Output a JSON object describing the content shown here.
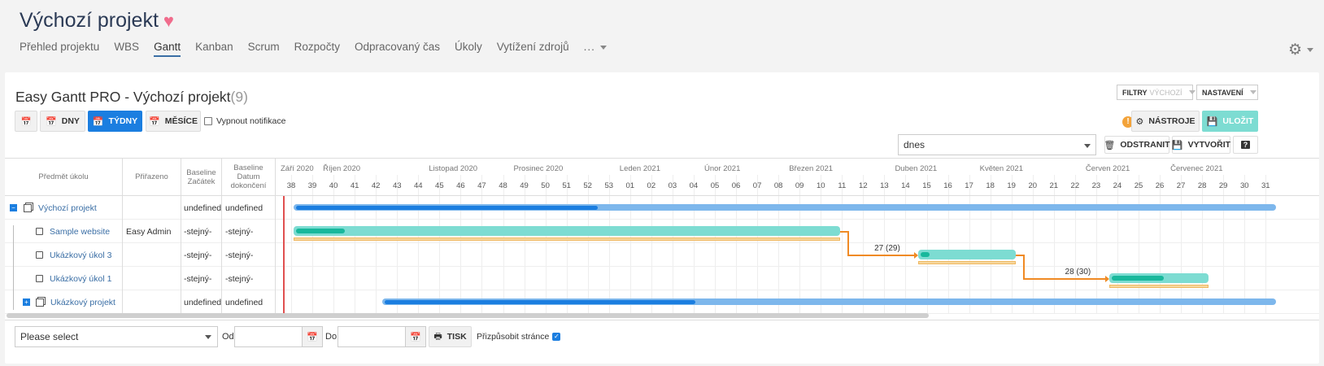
{
  "header": {
    "project_title": "Výchozí projekt",
    "tabs": [
      "Přehled projektu",
      "WBS",
      "Gantt",
      "Kanban",
      "Scrum",
      "Rozpočty",
      "Odpracovaný čas",
      "Úkoly",
      "Vytížení zdrojů"
    ],
    "active_tab": "Gantt",
    "more_label": "..."
  },
  "toolbar": {
    "title": "Easy Gantt PRO - Výchozí projekt",
    "count": "(9)",
    "filters_label": "FILTRY",
    "filters_value": "VÝCHOZÍ",
    "settings_label": "NASTAVENÍ",
    "days_label": "DNY",
    "weeks_label": "TÝDNY",
    "months_label": "MĚSÍCE",
    "notify_label": "Vypnout notifikace",
    "tools_label": "NÁSTROJE",
    "save_label": "ULOŽIT",
    "warning": "!",
    "today_select": "dnes",
    "remove_label": "ODSTRANIT",
    "create_label": "VYTVOŘIT",
    "help_label": "?"
  },
  "columns": {
    "subject": "Předmět úkolu",
    "assigned": "Přiřazeno",
    "baseline_start": "Baseline Začátek",
    "baseline_end": "Baseline Datum dokončení"
  },
  "rows": [
    {
      "subject": "Výchozí projekt",
      "assigned": "",
      "bstart": "undefined",
      "bend": "undefined"
    },
    {
      "subject": "Sample website",
      "assigned": "Easy Admin",
      "bstart": "-stejný-",
      "bend": "-stejný-"
    },
    {
      "subject": "Ukázkový úkol 3",
      "assigned": "",
      "bstart": "-stejný-",
      "bend": "-stejný-"
    },
    {
      "subject": "Ukázkový úkol 1",
      "assigned": "",
      "bstart": "-stejný-",
      "bend": "-stejný-"
    },
    {
      "subject": "Ukázkový projekt",
      "assigned": "",
      "bstart": "undefined",
      "bend": "undefined"
    }
  ],
  "timeline": {
    "months": [
      {
        "label": "Září 2020",
        "week": 38
      },
      {
        "label": "Říjen 2020",
        "week": 40
      },
      {
        "label": "Listopad 2020",
        "week": 45
      },
      {
        "label": "Prosinec 2020",
        "week": 49
      },
      {
        "label": "Leden 2021",
        "week": 54
      },
      {
        "label": "Únor 2021",
        "week": 58
      },
      {
        "label": "Březen 2021",
        "week": 62
      },
      {
        "label": "Duben 2021",
        "week": 67
      },
      {
        "label": "Květen 2021",
        "week": 71
      },
      {
        "label": "Červen 2021",
        "week": 76
      },
      {
        "label": "Červenec 2021",
        "week": 80
      }
    ],
    "weeks": [
      "38",
      "39",
      "40",
      "41",
      "42",
      "43",
      "44",
      "45",
      "46",
      "47",
      "48",
      "49",
      "50",
      "51",
      "52",
      "53",
      "01",
      "02",
      "03",
      "04",
      "05",
      "06",
      "07",
      "08",
      "09",
      "10",
      "11",
      "12",
      "13",
      "14",
      "15",
      "16",
      "17",
      "18",
      "19",
      "20",
      "21",
      "22",
      "23",
      "24",
      "25",
      "26",
      "27",
      "28",
      "29",
      "30",
      "31"
    ],
    "today_week": 38.1
  },
  "bars": [
    {
      "row": 0,
      "type": "project",
      "start": 38.6,
      "end": 85,
      "progress": 0.31
    },
    {
      "row": 1,
      "type": "task",
      "start": 38.6,
      "end": 64.4,
      "progress": 0.095,
      "baseline": true
    },
    {
      "row": 2,
      "type": "task",
      "start": 68.1,
      "end": 72.7,
      "progress": 0.12,
      "baseline": true
    },
    {
      "row": 3,
      "type": "task",
      "start": 77.1,
      "end": 81.8,
      "progress": 0.55,
      "baseline": true
    },
    {
      "row": 4,
      "type": "project",
      "start": 42.8,
      "end": 85,
      "progress": 0.35
    }
  ],
  "relations": [
    {
      "from": 1,
      "to": 2,
      "label": "27 (29)"
    },
    {
      "from": 2,
      "to": 3,
      "label": "28 (30)"
    }
  ],
  "footer": {
    "select_placeholder": "Please select",
    "from_label": "Od",
    "to_label": "Do",
    "print_label": "TISK",
    "fit_label": "Přizpůsobit stránce"
  },
  "colors": {
    "project_bar": "#7db7ec",
    "project_progress": "#1b7ee0",
    "task_bar": "#7ddcd2",
    "task_progress": "#18b89c",
    "baseline": "#f6d8a0",
    "relation": "#f08a24",
    "today": "#e05050"
  }
}
